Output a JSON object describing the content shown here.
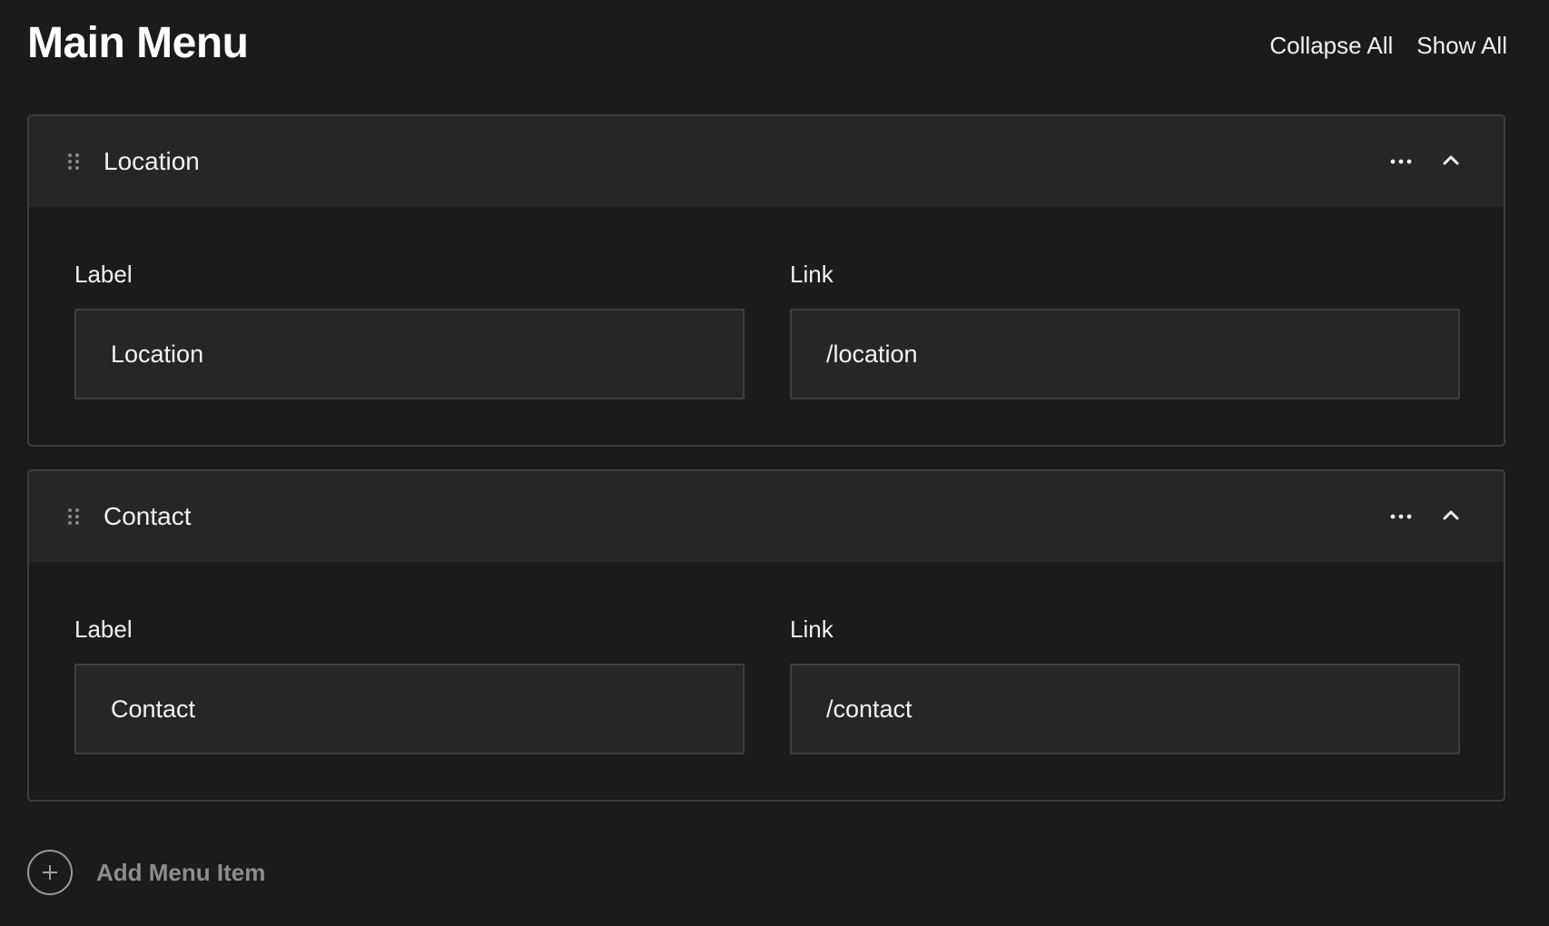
{
  "header": {
    "title": "Main Menu",
    "collapse_all": "Collapse All",
    "show_all": "Show All"
  },
  "menu_items": [
    {
      "title": "Location",
      "label_field_label": "Label",
      "link_field_label": "Link",
      "label_value": "Location",
      "link_value": "/location",
      "expanded": true
    },
    {
      "title": "Contact",
      "label_field_label": "Label",
      "link_field_label": "Link",
      "label_value": "Contact",
      "link_value": "/contact",
      "expanded": true
    }
  ],
  "add_item": {
    "label": "Add Menu Item"
  },
  "icons": {
    "drag": "drag-handle-icon",
    "more": "more-horizontal-icon",
    "collapse": "chevron-up-icon",
    "add": "plus-icon"
  },
  "colors": {
    "background": "#1b1b1b",
    "card_header": "#262626",
    "input_bg": "#262626",
    "border": "#3d3d3d",
    "text": "#f2f2f2",
    "muted": "#8d8d8d"
  }
}
